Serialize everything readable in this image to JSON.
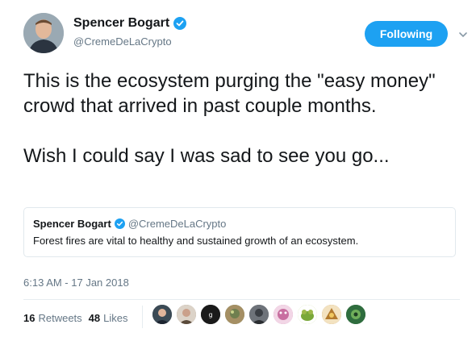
{
  "author": {
    "name": "Spencer Bogart",
    "handle": "@CremeDeLaCrypto",
    "verified": true
  },
  "follow_button": {
    "label": "Following",
    "color": "#1da1f2"
  },
  "tweet": {
    "text": "This is the ecosystem purging the \"easy money\" crowd that arrived in past couple months.\n\nWish I could say I was sad to see you go..."
  },
  "quoted_tweet": {
    "name": "Spencer Bogart",
    "handle": "@CremeDeLaCrypto",
    "text": "Forest fires are vital to healthy and sustained growth of an ecosystem."
  },
  "timestamp": "6:13 AM - 17 Jan 2018",
  "stats": {
    "retweets_count": "16",
    "retweets_label": "Retweets",
    "likes_count": "48",
    "likes_label": "Likes"
  },
  "likers": [
    {
      "icon": "liker-avatar-1",
      "color": "#3b4a55"
    },
    {
      "icon": "liker-avatar-2",
      "color": "#8a7a6a"
    },
    {
      "icon": "liker-avatar-3",
      "color": "#222222"
    },
    {
      "icon": "liker-avatar-4",
      "color": "#7a8c6b"
    },
    {
      "icon": "liker-avatar-5",
      "color": "#555a60"
    },
    {
      "icon": "liker-avatar-6",
      "color": "#c86fa0"
    },
    {
      "icon": "liker-avatar-7",
      "color": "#9db84a"
    },
    {
      "icon": "liker-avatar-8",
      "color": "#b37a2e"
    },
    {
      "icon": "liker-avatar-9",
      "color": "#2f6d3e"
    }
  ]
}
